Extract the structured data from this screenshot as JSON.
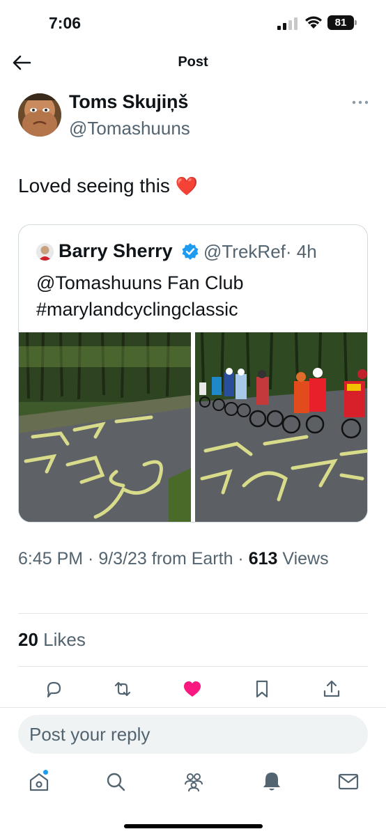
{
  "status_bar": {
    "time": "7:06",
    "battery": "81"
  },
  "header": {
    "title": "Post"
  },
  "post": {
    "author_name": "Toms Skujiņš",
    "author_handle": "@Tomashuuns",
    "text": "Loved seeing this",
    "emoji": "❤️",
    "time": "6:45 PM · 9/3/23",
    "source": "from Earth",
    "views_count": "613",
    "views_label": " Views",
    "likes_count": "20",
    "likes_label": " Likes"
  },
  "quote": {
    "author_name": "Barry Sherry",
    "author_handle": "@TrekRef",
    "age": "· 4h",
    "line1": "@Tomashuuns Fan Club",
    "line2": "#marylandcyclingclassic"
  },
  "reply": {
    "placeholder": "Post your reply"
  },
  "colors": {
    "like_pink": "#f91880",
    "verified_blue": "#1d9bf0",
    "muted": "#536471"
  },
  "icons": [
    "back-arrow-icon",
    "more-icon",
    "verified-icon",
    "reply-icon",
    "repost-icon",
    "like-icon",
    "bookmark-icon",
    "share-icon",
    "home-icon",
    "search-icon",
    "communities-icon",
    "notifications-icon",
    "messages-icon"
  ]
}
